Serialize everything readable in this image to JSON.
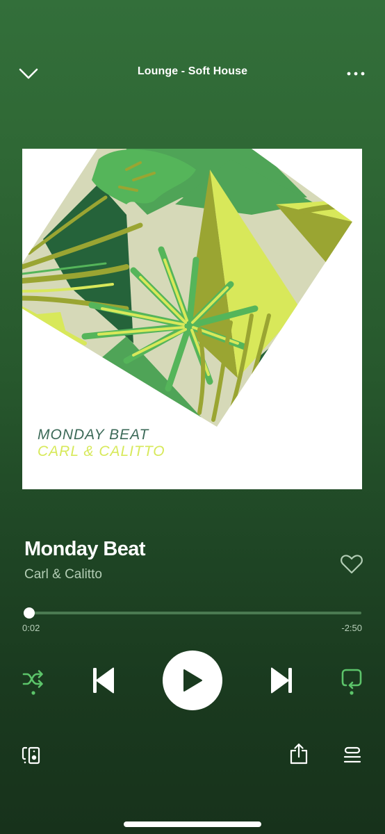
{
  "header": {
    "title": "Lounge - Soft House",
    "collapse_icon": "chevron-down-icon",
    "more_icon": "more-horizontal-icon"
  },
  "album_art": {
    "title_text": "MONDAY BEAT",
    "artist_text": "CARL & CALITTO",
    "colors": {
      "background": "#ffffff",
      "beige": "#d6d9b8",
      "mid_green": "#4fa457",
      "dark_green": "#25633a",
      "olive": "#9aa532",
      "lime": "#d8e85a",
      "leaf_green": "#55b55a"
    }
  },
  "track": {
    "title": "Monday Beat",
    "artist": "Carl & Calitto",
    "liked": false,
    "like_icon": "heart-outline-icon"
  },
  "playback": {
    "elapsed": "0:02",
    "remaining": "-2:50",
    "progress_fraction": 0.012,
    "is_playing": false,
    "shuffle_enabled": true,
    "repeat_enabled": true,
    "accent_color": "#5cc46a"
  },
  "controls": {
    "shuffle_icon": "shuffle-icon",
    "previous_icon": "skip-previous-icon",
    "play_icon": "play-icon",
    "next_icon": "skip-next-icon",
    "repeat_icon": "repeat-icon"
  },
  "bottom_bar": {
    "devices_icon": "connect-devices-icon",
    "share_icon": "share-icon",
    "queue_icon": "queue-icon"
  }
}
